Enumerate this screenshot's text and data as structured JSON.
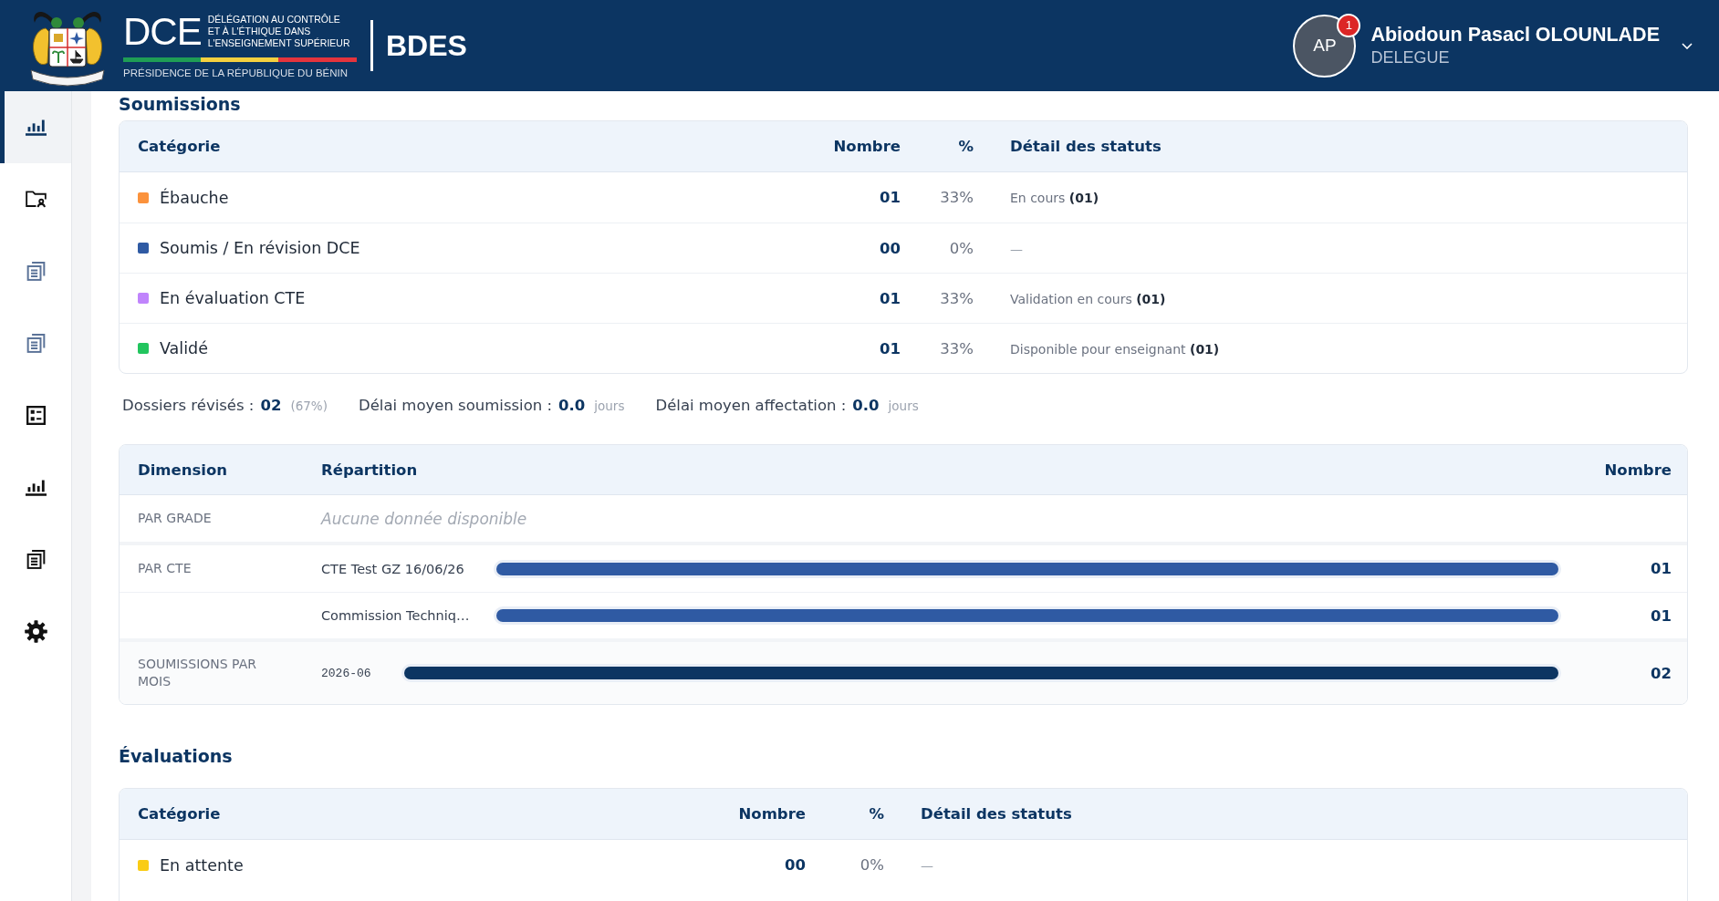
{
  "header": {
    "logo": {
      "acronym": "DCE",
      "name_lines": [
        "DÉLÉGATION AU CONTRÔLE",
        "ET À L'ÉTHIQUE DANS",
        "L'ENSEIGNEMENT SUPÉRIEUR"
      ],
      "subtitle": "PRÉSIDENCE DE LA RÉPUBLIQUE DU BÉNIN"
    },
    "app_name": "BDES",
    "user": {
      "initials": "AP",
      "notifications": "1",
      "name": "Abiodoun Pasacl OLOUNLADE",
      "role": "DELEGUE"
    }
  },
  "sidebar": {
    "items": [
      {
        "selected": true,
        "disabled": false
      },
      {
        "selected": false,
        "disabled": false
      },
      {
        "selected": false,
        "disabled": true
      },
      {
        "selected": false,
        "disabled": true
      },
      {
        "selected": false,
        "disabled": false
      },
      {
        "selected": false,
        "disabled": false
      },
      {
        "selected": false,
        "disabled": false
      },
      {
        "selected": false,
        "disabled": false
      }
    ]
  },
  "sections": [
    {
      "title": "Soumissions",
      "status_table": {
        "columns": [
          "Catégorie",
          "Nombre",
          "%",
          "Détail des statuts"
        ],
        "rows": [
          {
            "label": "Ébauche",
            "color": "#fb923c",
            "count": "01",
            "percent": "33%",
            "detail": "En cours **(01)**",
            "detail_muted": false
          },
          {
            "label": "Soumis / En révision DCE",
            "color": "#2f5aa3",
            "count": "00",
            "percent": "0%",
            "detail": "—",
            "detail_muted": true
          },
          {
            "label": "En évaluation CTE",
            "color": "#c084fc",
            "count": "01",
            "percent": "33%",
            "detail": "Validation en cours **(01)**",
            "detail_muted": false
          },
          {
            "label": "Validé",
            "color": "#22c55e",
            "count": "01",
            "percent": "33%",
            "detail": "Disponible pour enseignant **(01)**",
            "detail_muted": false
          }
        ]
      },
      "summary": [
        {
          "label": "Dossiers révisés :",
          "value": "02",
          "note": "(67%)"
        },
        {
          "label": "Délai moyen soumission :",
          "value": "0.0",
          "note": "jours"
        },
        {
          "label": "Délai moyen affectation :",
          "value": "0.0",
          "note": "jours"
        }
      ],
      "distribution_table": {
        "columns": [
          "Dimension",
          "Répartition",
          "Nombre"
        ],
        "groups": [
          {
            "kind": "empty",
            "dimension": "PAR GRADE",
            "message": "Aucune donnée disponible"
          },
          {
            "kind": "category",
            "dimension": "PAR CTE",
            "rows": [
              {
                "label": "CTE Test GZ 16/06/26",
                "level": 1,
                "count": "01"
              },
              {
                "label": "Commission Techniq…",
                "level": 1,
                "count": "01"
              }
            ]
          },
          {
            "kind": "month",
            "dimension": "SOUMISSIONS PAR MOIS",
            "rows": [
              {
                "label": "2026-06",
                "level": 1,
                "count": "02"
              }
            ]
          }
        ]
      }
    },
    {
      "title": "Évaluations",
      "status_table": {
        "columns": [
          "Catégorie",
          "Nombre",
          "%",
          "Détail des statuts"
        ],
        "rows": [
          {
            "label": "En attente",
            "color": "#facc15",
            "count": "00",
            "percent": "0%",
            "detail": "—",
            "detail_muted": true
          }
        ]
      }
    }
  ]
}
